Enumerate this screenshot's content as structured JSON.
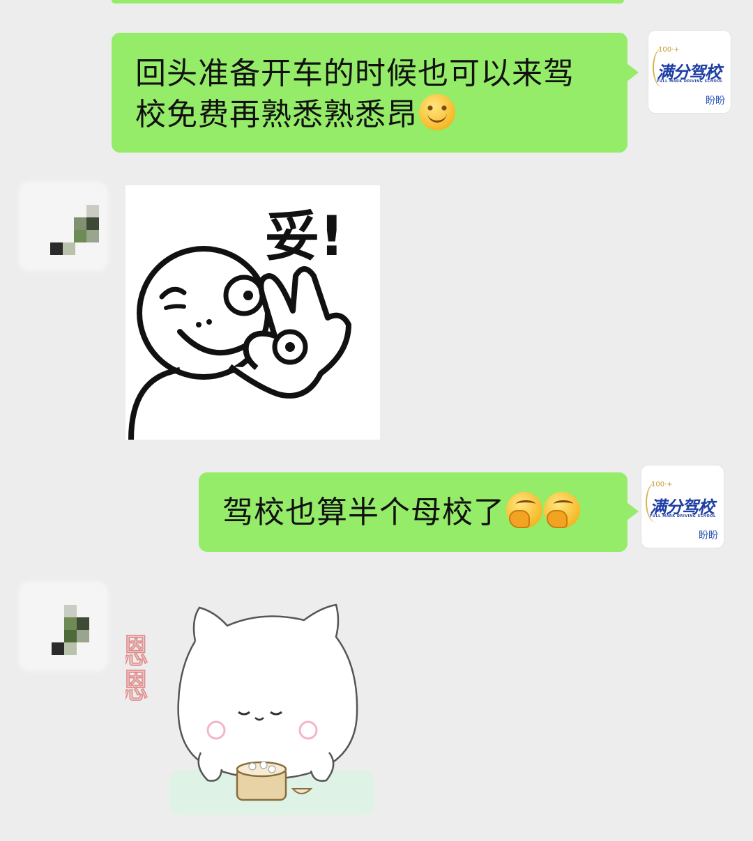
{
  "messages": [
    {
      "side": "right",
      "type": "text",
      "text": "回头准备开车的时候也可以来驾校免费再熟悉熟悉昂",
      "emoji": [
        "smiling-face-icon"
      ]
    },
    {
      "side": "left",
      "type": "sticker",
      "sticker_text": "妥!",
      "sticker": "winking-ok-hand-sticker"
    },
    {
      "side": "right",
      "type": "text",
      "text": "驾校也算半个母校了",
      "emoji": [
        "thinking-face-icon",
        "thinking-face-icon"
      ]
    },
    {
      "side": "left",
      "type": "sticker",
      "sticker_text": "嗯嗯",
      "sticker": "white-cat-eating-dumplings-sticker"
    }
  ],
  "school_avatar": {
    "top_text": "100·+",
    "logo_text": "满分驾校",
    "logo_subtext": "FULL MARK DRIVING SCHOOL",
    "name": "盼盼"
  },
  "colors": {
    "background": "#ededed",
    "bubble_green": "#95ec69",
    "logo_blue": "#1f3fa6"
  }
}
